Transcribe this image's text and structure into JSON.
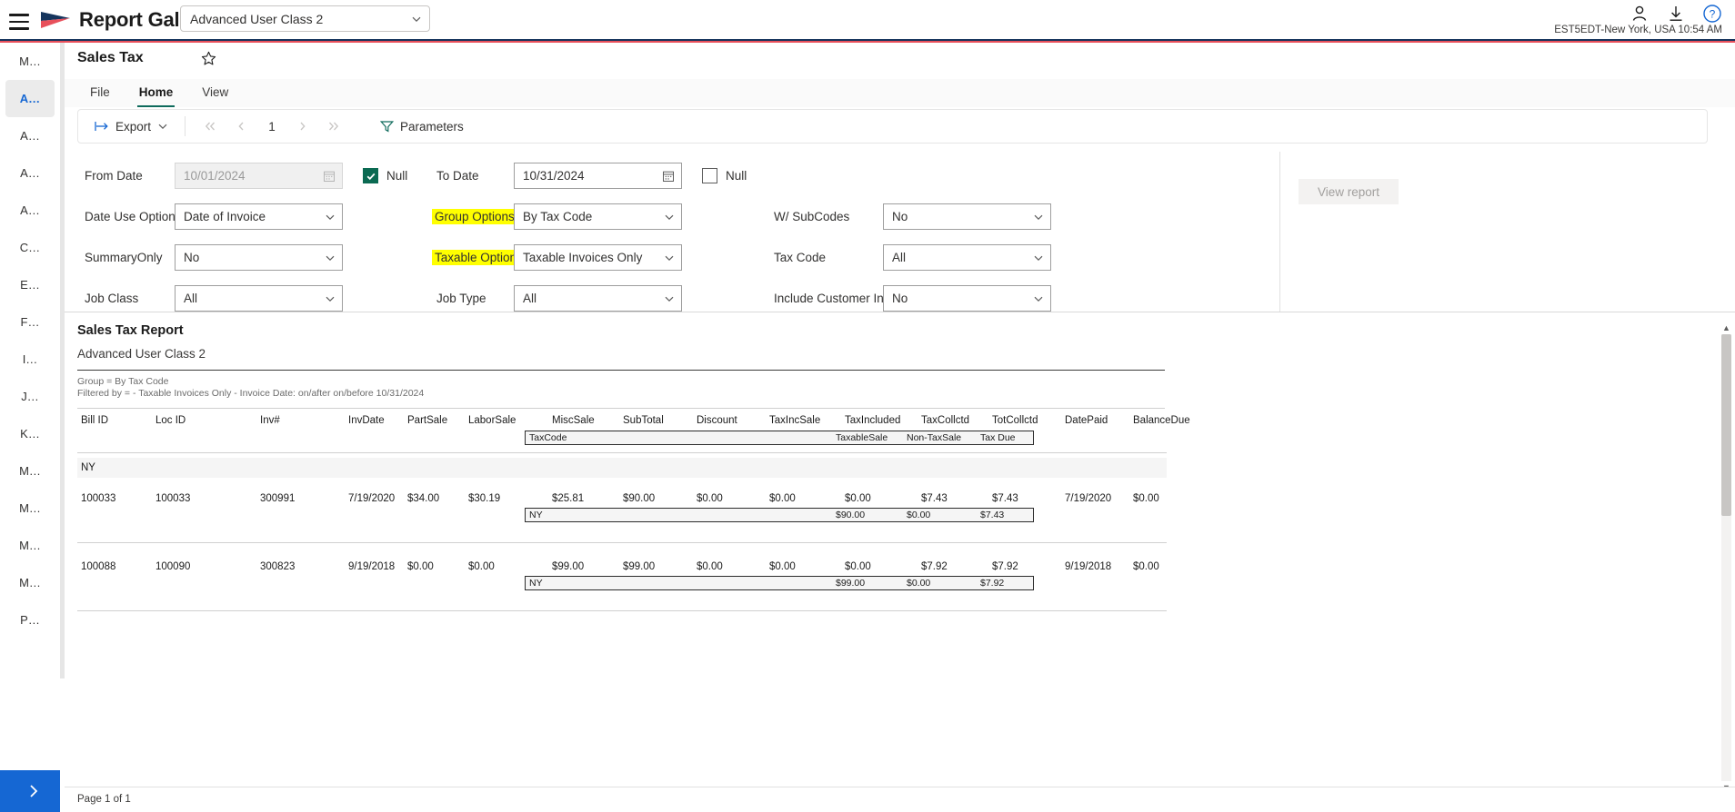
{
  "header": {
    "brand": "Report Gallery",
    "menu_icon": "hamburger-icon",
    "class_selector": {
      "value": "Advanced User Class 2"
    },
    "icons": {
      "account": "person-icon",
      "download": "download-icon",
      "help": "help-icon"
    },
    "timezone": "EST5EDT-New York, USA 10:54 AM"
  },
  "sidebar": {
    "items": [
      {
        "label": "M…",
        "selected": false
      },
      {
        "label": "A…",
        "selected": true
      },
      {
        "label": "A…",
        "selected": false
      },
      {
        "label": "A…",
        "selected": false
      },
      {
        "label": "A…",
        "selected": false
      },
      {
        "label": "C…",
        "selected": false
      },
      {
        "label": "E…",
        "selected": false
      },
      {
        "label": "F…",
        "selected": false
      },
      {
        "label": "I…",
        "selected": false
      },
      {
        "label": "J…",
        "selected": false
      },
      {
        "label": "K…",
        "selected": false
      },
      {
        "label": "M…",
        "selected": false
      },
      {
        "label": "M…",
        "selected": false
      },
      {
        "label": "M…",
        "selected": false
      },
      {
        "label": "M…",
        "selected": false
      },
      {
        "label": "P…",
        "selected": false
      }
    ],
    "expand_button": "expand-sidebar"
  },
  "page": {
    "title": "Sales Tax",
    "favorite_icon": "star-icon",
    "tabs": [
      {
        "label": "File",
        "active": false
      },
      {
        "label": "Home",
        "active": true
      },
      {
        "label": "View",
        "active": false
      }
    ]
  },
  "toolbar": {
    "export_label": "Export",
    "page_number": "1",
    "parameters_label": "Parameters",
    "first_icon": "first-page-icon",
    "prev_icon": "previous-page-icon",
    "next_icon": "next-page-icon",
    "last_icon": "last-page-icon",
    "filter_icon": "filter-icon"
  },
  "parameters": {
    "view_report_label": "View report",
    "fields": [
      {
        "label": "From Date",
        "value": "10/01/2024",
        "disabled": true,
        "kind": "date",
        "null_label": "Null",
        "null_checked": true,
        "highlight": false
      },
      {
        "label": "To Date",
        "value": "10/31/2024",
        "disabled": false,
        "kind": "date",
        "null_label": "Null",
        "null_checked": false,
        "highlight": false
      },
      {
        "label": "Date Use Options",
        "value": "Date of Invoice",
        "kind": "select",
        "highlight": false
      },
      {
        "label": "Group Options",
        "value": "By Tax Code",
        "kind": "select",
        "highlight": true
      },
      {
        "label": "W/ SubCodes",
        "value": "No",
        "kind": "select",
        "highlight": false
      },
      {
        "label": "SummaryOnly",
        "value": "No",
        "kind": "select",
        "highlight": false
      },
      {
        "label": "Taxable Options",
        "value": "Taxable Invoices Only",
        "kind": "select",
        "highlight": true
      },
      {
        "label": "Tax Code",
        "value": "All",
        "kind": "select",
        "highlight": false
      },
      {
        "label": "Job Class",
        "value": "All",
        "kind": "select",
        "highlight": false
      },
      {
        "label": "Job Type",
        "value": "All",
        "kind": "select",
        "highlight": false
      },
      {
        "label": "Include Customer Info",
        "value": "No",
        "kind": "select",
        "highlight": false
      }
    ]
  },
  "report": {
    "title": "Sales Tax Report",
    "subtitle": "Advanced User Class 2",
    "meta_line_1": "Group = By Tax Code",
    "meta_line_2": "Filtered by =  - Taxable Invoices Only - Invoice Date: on/after  on/before 10/31/2024",
    "columns": [
      "Bill ID",
      "Loc ID",
      "Inv#",
      "InvDate",
      "PartSale",
      "LaborSale",
      "MiscSale",
      "SubTotal",
      "Discount",
      "TaxIncSale",
      "TaxIncluded",
      "TaxCollctd",
      "TotCollctd",
      "DatePaid",
      "BalanceDue"
    ],
    "sub_header": [
      "TaxCode",
      "TaxableSale",
      "Non-TaxSale",
      "Tax Due"
    ],
    "group_label": "NY",
    "rows": [
      {
        "cells": [
          "100033",
          "100033",
          "300991",
          "7/19/2020",
          "$34.00",
          "$30.19",
          "$25.81",
          "$90.00",
          "$0.00",
          "$0.00",
          "$0.00",
          "$7.43",
          "$7.43",
          "7/19/2020",
          "$0.00"
        ],
        "sub": [
          "NY",
          "$90.00",
          "$0.00",
          "$7.43"
        ]
      },
      {
        "cells": [
          "100088",
          "100090",
          "300823",
          "9/19/2018",
          "$0.00",
          "$0.00",
          "$99.00",
          "$99.00",
          "$0.00",
          "$0.00",
          "$0.00",
          "$7.92",
          "$7.92",
          "9/19/2018",
          "$0.00"
        ],
        "sub": [
          "NY",
          "$99.00",
          "$0.00",
          "$7.92"
        ]
      }
    ],
    "status": "Page 1 of 1"
  }
}
